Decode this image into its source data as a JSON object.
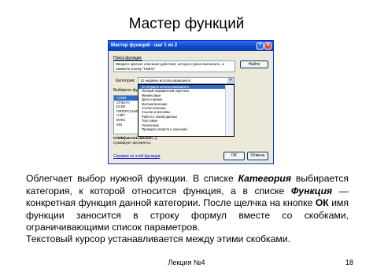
{
  "slide": {
    "title": "Мастер функций",
    "footer_lecture": "Лекция №4",
    "page_number": "18"
  },
  "dialog": {
    "title": "Мастер функций - шаг 1 из 2",
    "help_icon": "?",
    "close_icon": "✕",
    "search_label": "Поиск функции:",
    "search_text": "Введите краткое описание действия, которое нужно выполнить, и нажмите кнопку \"Найти\"",
    "find_button": "Найти",
    "category_label": "Категория:",
    "category_value": "10 недавно использовавшихся",
    "select_function_label": "Выберите функцию:",
    "functions": [
      "СУММ",
      "СРЗНАЧ",
      "ЕСЛИ",
      "ГИПЕРССЫЛКА",
      "СЧЁТ",
      "МАКС",
      "SIN"
    ],
    "categories": [
      "10 недавно использовавшихся",
      "Полный алфавитный перечень",
      "Финансовые",
      "Дата и время",
      "Математические",
      "Статистические",
      "Ссылки и массивы",
      "Работа с базой данных",
      "Текстовые",
      "Логические",
      "Проверка свойств и значений"
    ],
    "func_signature": "СУММ(число1;число2;...)",
    "func_description": "Суммирует аргументы.",
    "help_link": "Справка по этой функции",
    "ok_button": "OK",
    "cancel_button": "Отмена"
  },
  "text": {
    "p1_a": "Облегчает выбор нужной функции. В списке ",
    "p1_b": "Категория",
    "p1_c": " выбирается категория, к которой относится функция, а в списке ",
    "p1_d": "Функция",
    "p1_e": " — конкретная функция данной категории. После щелчка на кнопке ",
    "p1_f": "ОК",
    "p1_g": " имя функции заносится в строку формул вместе со скобками, ограничивающими список параметров.",
    "p2": "Текстовый курсор устанавливается между этими скобками."
  }
}
